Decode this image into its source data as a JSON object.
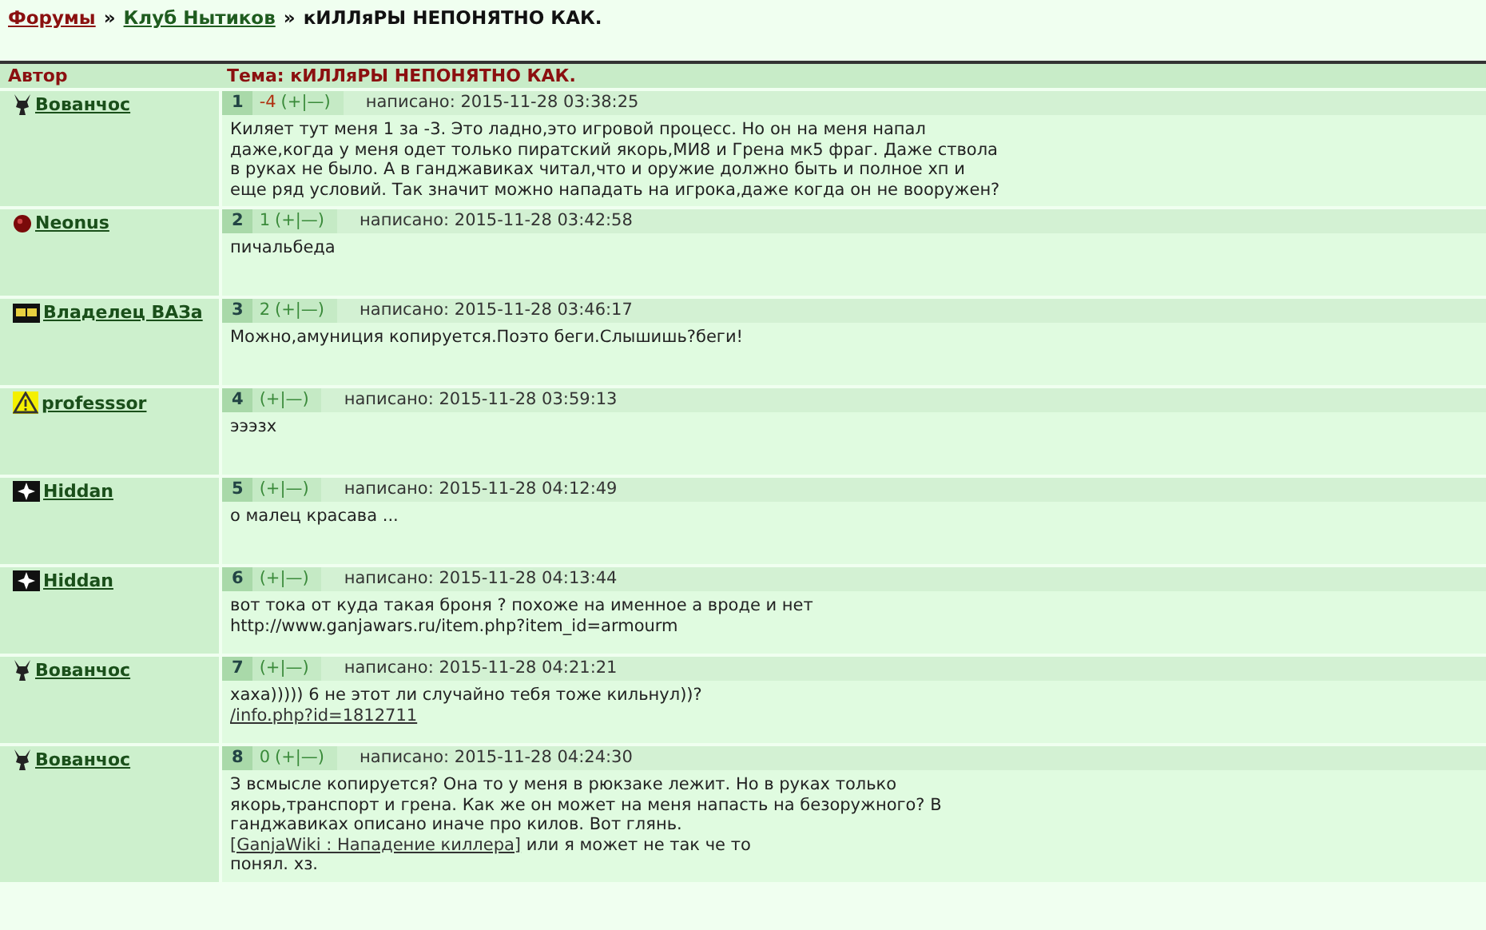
{
  "breadcrumb": {
    "links": [
      "Форумы",
      "Клуб Нытиков"
    ],
    "separator": "»",
    "current": "кИЛЛяРЫ НЕПОНЯТНО КАК."
  },
  "table": {
    "author_header": "Автор",
    "topic_header": "Тема: кИЛЛяРЫ НЕПОНЯТНО КАК.",
    "posts": [
      {
        "author": "Вованчос",
        "avatar": {
          "kind": "figure"
        },
        "number": "1",
        "rating": {
          "text": "-4",
          "negative": true
        },
        "vote": "(+|—)",
        "written": "написано: 2015-11-28 03:38:25",
        "paragraphs": [
          [
            {
              "kind": "text",
              "text": "Киляет тут меня 1 за -3. Это ладно,это игровой процесс. Но он на меня напал даже,когда у меня одет только пиратский якорь,МИ8 и Грена мк5 фраг. Даже ствола в руках не было. А в ганджавиках читал,что и оружие должно быть и полное хп и еще ряд условий. Так значит можно нападать на игрока,даже когда он не вооружен?"
            }
          ]
        ]
      },
      {
        "author": "Neonus",
        "avatar": {
          "kind": "ball"
        },
        "number": "2",
        "rating": {
          "text": "1",
          "negative": false
        },
        "vote": "(+|—)",
        "written": "написано: 2015-11-28 03:42:58",
        "paragraphs": [
          [
            {
              "kind": "text",
              "text": "пичальбеда"
            }
          ]
        ]
      },
      {
        "author": "Владелец ВАЗа",
        "avatar": {
          "kind": "plate"
        },
        "number": "3",
        "rating": {
          "text": "2",
          "negative": false
        },
        "vote": "(+|—)",
        "written": "написано: 2015-11-28 03:46:17",
        "paragraphs": [
          [
            {
              "kind": "text",
              "text": "Можно,амуниция копируется.Поэто беги.Слышишь?беги!"
            }
          ]
        ]
      },
      {
        "author": "professsor",
        "avatar": {
          "kind": "warning"
        },
        "number": "4",
        "vote": "(+|—)",
        "written": "написано: 2015-11-28 03:59:13",
        "paragraphs": [
          [
            {
              "kind": "text",
              "text": "эээзх"
            }
          ]
        ]
      },
      {
        "author": "Hiddan",
        "avatar": {
          "kind": "cross"
        },
        "number": "5",
        "vote": "(+|—)",
        "written": "написано: 2015-11-28 04:12:49",
        "paragraphs": [
          [
            {
              "kind": "text",
              "text": "о малец красава ..."
            }
          ]
        ]
      },
      {
        "author": "Hiddan",
        "avatar": {
          "kind": "cross"
        },
        "number": "6",
        "vote": "(+|—)",
        "written": "написано: 2015-11-28 04:13:44",
        "paragraphs": [
          [
            {
              "kind": "text",
              "text": "вот тока от куда такая броня ? похоже на именное а вроде и нет"
            }
          ],
          [
            {
              "kind": "text",
              "text": "http://www.ganjawars.ru/item.php?item_id=armourm"
            }
          ]
        ]
      },
      {
        "author": "Вованчос",
        "avatar": {
          "kind": "figure"
        },
        "number": "7",
        "vote": "(+|—)",
        "written": "написано: 2015-11-28 04:21:21",
        "paragraphs": [
          [
            {
              "kind": "text",
              "text": "хаха))))) 6 не этот ли случайно тебя тоже кильнул))?"
            }
          ],
          [
            {
              "kind": "link",
              "text": "/info.php?id=1812711"
            }
          ]
        ]
      },
      {
        "author": "Вованчос",
        "avatar": {
          "kind": "figure"
        },
        "number": "8",
        "rating": {
          "text": "0",
          "negative": false
        },
        "vote": "(+|—)",
        "written": "написано: 2015-11-28 04:24:30",
        "paragraphs": [
          [
            {
              "kind": "text",
              "text": "З всмысле копируется? Она то у меня в рюкзаке лежит. Но в руках только якорь,транспорт и грена. Как же он может на меня напасть на безоружного? В ганджавиках описано иначе про килов. Вот глянь."
            }
          ],
          [
            {
              "kind": "link",
              "text": "[GanjaWiki : Нападение  киллера]"
            },
            {
              "kind": "text",
              "text": " или я может не так че то"
            }
          ],
          [
            {
              "kind": "text",
              "text": "понял. хз."
            }
          ]
        ]
      }
    ]
  }
}
